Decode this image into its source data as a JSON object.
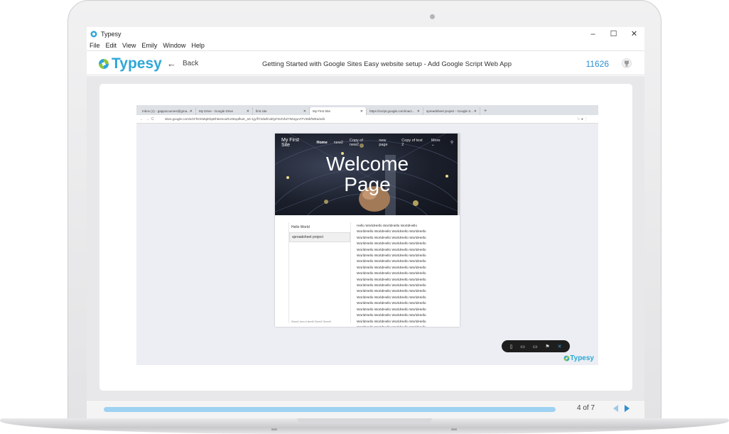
{
  "window": {
    "title": "Typesy",
    "minimize": "–",
    "maximize": "☐",
    "close": "✕"
  },
  "menu": [
    "File",
    "Edit",
    "View",
    "Emily",
    "Window",
    "Help"
  ],
  "header": {
    "logo_text": "Typesy",
    "back_label": "Back",
    "course_title": "Getting Started with Google Sites Easy website setup - Add Google Script Web App",
    "points": "11626",
    "trophy_icon": "trophy-icon"
  },
  "video": {
    "browser_tabs": [
      {
        "label": "Inbox (1) - gappscourses@gma...",
        "active": false
      },
      {
        "label": "My Drive - Google Drive",
        "active": false
      },
      {
        "label": "first site",
        "active": false
      },
      {
        "label": "My First Site",
        "active": true
      },
      {
        "label": "https://script.google.com/macr...",
        "active": false
      },
      {
        "label": "spreadsheet project - Google S...",
        "active": false
      }
    ],
    "url": "sites.google.com/s/1FhGKMqiKbpDh6smouRoXEqufkuK_aX-1jy/f/72dwfrUdQZYe2VkZ7WUgLVITV36bfWEa/edit",
    "site": {
      "name": "My First Site",
      "nav": [
        "Home",
        "new2",
        "Copy of new2",
        "new page",
        "Copy of test 2",
        "More ⌄"
      ],
      "hero_line1": "Welcome",
      "hero_line2": "Page",
      "sidebar_hello": "Hello World",
      "sidebar_sheet": "spreadsheet project",
      "sidebar_footer": "Sheet1   Item   A   itemB   Sheet2   Sheet3",
      "body_first_line": "Hello WorldHello WorldHello WorldHello",
      "body_line": "WorldHello WorldHello WorldHello WorldHello",
      "body_line_count": 17
    },
    "brand_watermark": "Typesy"
  },
  "footer": {
    "progress_percent": 100,
    "page_indicator": "4 of 7"
  },
  "colors": {
    "brand": "#2fa7d7",
    "points": "#2f8fd0",
    "progress": "#9ed2f2"
  }
}
